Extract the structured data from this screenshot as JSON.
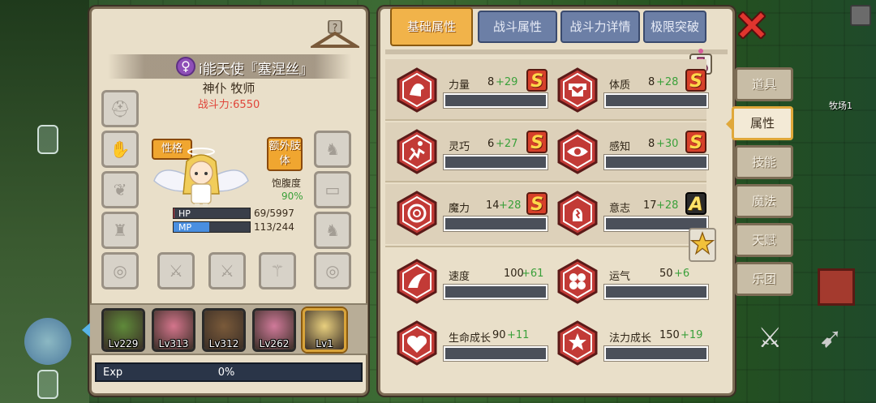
{
  "world": {
    "ranch_label": "牧场1"
  },
  "character": {
    "name": "i能天使『塞涅丝』",
    "gender_symbol": "♀",
    "class_line": "神仆 牧师",
    "power": "战斗力:6550",
    "personality_btn": "性格",
    "extra_limb_btn": "额外肢体",
    "satiety_label": "饱腹度",
    "satiety_value": "90%",
    "hp_label": "HP",
    "hp_value": "69/5997",
    "hp_fill": 0.0115,
    "mp_label": "MP",
    "mp_value": "113/244",
    "mp_fill": 0.463,
    "exp_label": "Exp",
    "exp_value": "0%"
  },
  "team": [
    {
      "level": "Lv229",
      "color": "#5f8a3a"
    },
    {
      "level": "Lv313",
      "color": "#d4758c"
    },
    {
      "level": "Lv312",
      "color": "#7a5a3a"
    },
    {
      "level": "Lv262",
      "color": "#d07a9a"
    },
    {
      "level": "Lv1",
      "color": "#e8cf7e"
    }
  ],
  "tabs": [
    "基础属性",
    "战斗属性",
    "战斗力详情",
    "极限突破"
  ],
  "active_tab": "基础属性",
  "stats": [
    {
      "name": "力量",
      "base": "8",
      "bonus": "+29",
      "grade": "S",
      "icon": "strength-icon"
    },
    {
      "name": "体质",
      "base": "8",
      "bonus": "+28",
      "grade": "S",
      "icon": "constitution-icon"
    },
    {
      "name": "灵巧",
      "base": "6",
      "bonus": "+27",
      "grade": "S",
      "icon": "agility-icon"
    },
    {
      "name": "感知",
      "base": "8",
      "bonus": "+30",
      "grade": "S",
      "icon": "perception-icon"
    },
    {
      "name": "魔力",
      "base": "14",
      "bonus": "+28",
      "grade": "S",
      "icon": "magic-icon"
    },
    {
      "name": "意志",
      "base": "17",
      "bonus": "+28",
      "grade": "A",
      "icon": "will-icon"
    },
    {
      "name": "速度",
      "base": "100",
      "bonus": "+61",
      "grade": "",
      "icon": "speed-icon"
    },
    {
      "name": "运气",
      "base": "50",
      "bonus": "+6",
      "grade": "",
      "icon": "luck-icon"
    },
    {
      "name": "生命成长",
      "base": "90",
      "bonus": "+11",
      "grade": "",
      "icon": "life-growth-icon"
    },
    {
      "name": "法力成长",
      "base": "150",
      "bonus": "+19",
      "grade": "",
      "icon": "mana-growth-icon"
    }
  ],
  "side_nav": [
    "道具",
    "属性",
    "技能",
    "魔法",
    "天赋",
    "乐团"
  ],
  "side_nav_active": "属性",
  "colors": {
    "hp": "#c8353a",
    "mp": "#4a8fe0",
    "accent": "#f1b34a",
    "bonus": "#3aa03a"
  }
}
